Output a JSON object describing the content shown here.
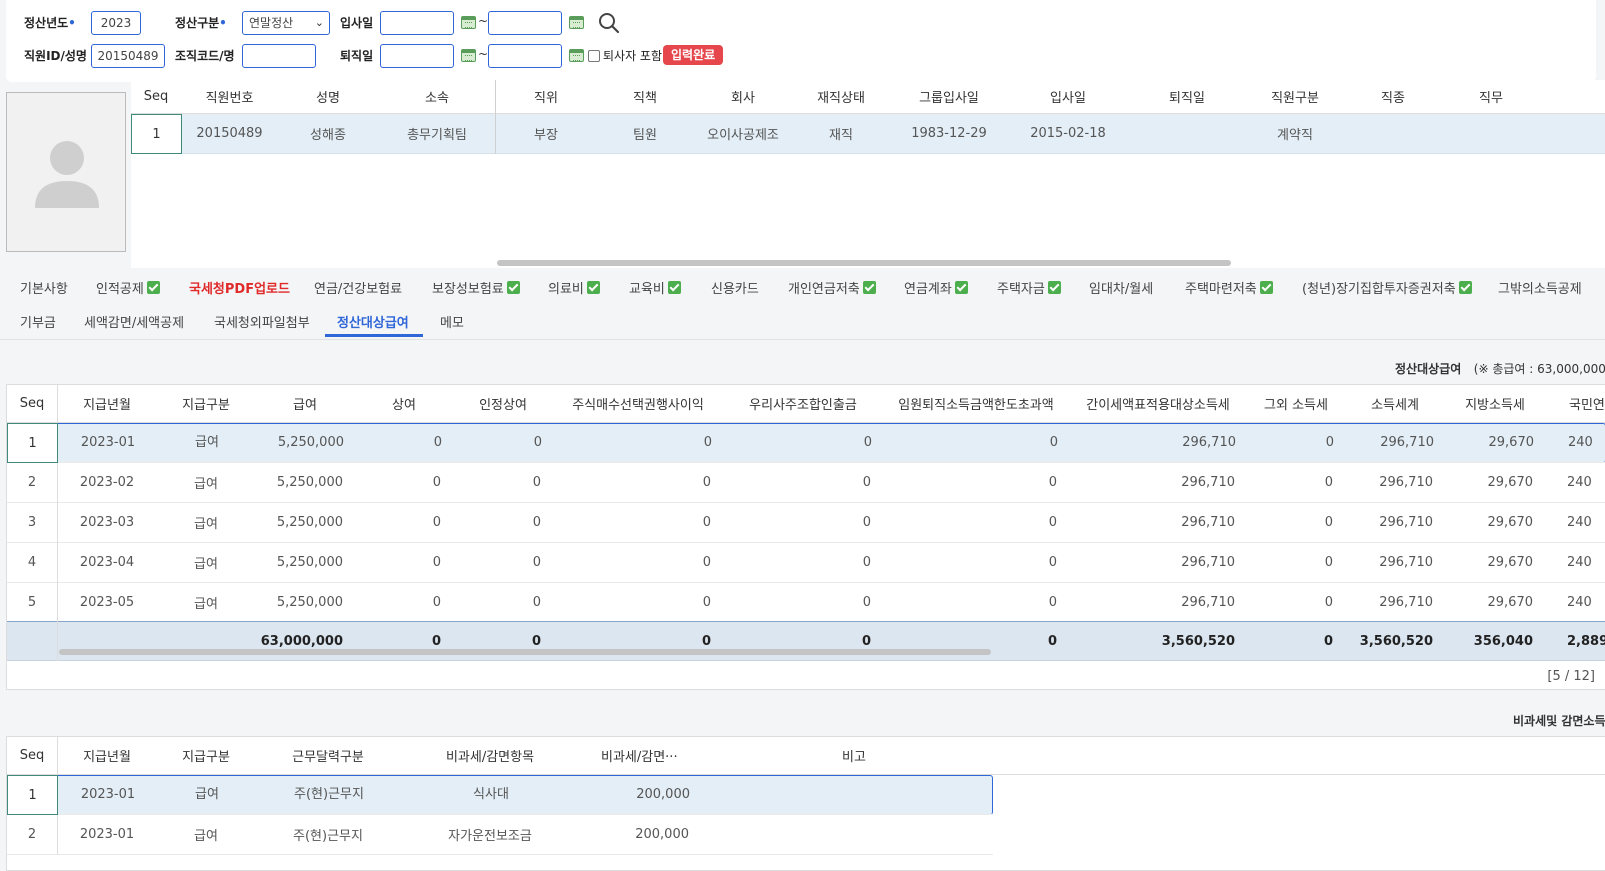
{
  "search": {
    "year_label": "정산년도",
    "year_value": "2023",
    "type_label": "정산구분",
    "type_value": "연말정산",
    "join_label": "입사일",
    "empid_label": "직원ID/성명",
    "empid_value": "20150489",
    "org_label": "조직코드/명",
    "retire_label": "퇴직일",
    "tilde": "~",
    "retiree_label": "퇴사자 포함",
    "status_badge": "입력완료",
    "required_mark": "•"
  },
  "employee_grid": {
    "columns": [
      "Seq",
      "직원번호",
      "성명",
      "소속",
      "직위",
      "직책",
      "회사",
      "재직상태",
      "그룹입사일",
      "입사일",
      "퇴직일",
      "직원구분",
      "직종",
      "직무"
    ],
    "row": [
      "1",
      "20150489",
      "성해종",
      "총무기획팀",
      "부장",
      "팀원",
      "오이사공제조",
      "재직",
      "1983-12-29",
      "2015-02-18",
      "",
      "계약직",
      "",
      ""
    ]
  },
  "tabs": {
    "row1": [
      {
        "label": "기본사항",
        "checked": false
      },
      {
        "label": "인적공제",
        "checked": true
      },
      {
        "label": "국세청PDF업로드",
        "checked": false
      },
      {
        "label": "연금/건강보험료",
        "checked": false
      },
      {
        "label": "보장성보험료",
        "checked": true
      },
      {
        "label": "의료비",
        "checked": true
      },
      {
        "label": "교육비",
        "checked": true
      },
      {
        "label": "신용카드",
        "checked": false
      },
      {
        "label": "개인연금저축",
        "checked": true
      },
      {
        "label": "연금계좌",
        "checked": true
      },
      {
        "label": "주택자금",
        "checked": true
      },
      {
        "label": "임대차/월세",
        "checked": false
      },
      {
        "label": "주택마련저축",
        "checked": true
      },
      {
        "label": "(청년)장기집합투자증권저축",
        "checked": true
      },
      {
        "label": "그밖의소득공제",
        "checked": false
      }
    ],
    "row2": [
      {
        "label": "기부금"
      },
      {
        "label": "세액감면/세액공제"
      },
      {
        "label": "국세청외파일첨부"
      },
      {
        "label": "정산대상급여"
      },
      {
        "label": "메모"
      }
    ],
    "active": "정산대상급여"
  },
  "salary": {
    "title": "정산대상급여",
    "total_note": "(※ 총급여 : 63,000,000)",
    "columns": [
      "Seq",
      "지급년월",
      "지급구분",
      "급여",
      "상여",
      "인정상여",
      "주식매수선택권행사이익",
      "우리사주조합인출금",
      "임원퇴직소득금액한도초과액",
      "간이세액표적용대상소득세",
      "그외 소득세",
      "소득세계",
      "지방소득세",
      "국민연"
    ],
    "rows": [
      [
        "1",
        "2023-01",
        "급여",
        "5,250,000",
        "0",
        "0",
        "0",
        "0",
        "0",
        "296,710",
        "0",
        "296,710",
        "29,670",
        "240"
      ],
      [
        "2",
        "2023-02",
        "급여",
        "5,250,000",
        "0",
        "0",
        "0",
        "0",
        "0",
        "296,710",
        "0",
        "296,710",
        "29,670",
        "240"
      ],
      [
        "3",
        "2023-03",
        "급여",
        "5,250,000",
        "0",
        "0",
        "0",
        "0",
        "0",
        "296,710",
        "0",
        "296,710",
        "29,670",
        "240"
      ],
      [
        "4",
        "2023-04",
        "급여",
        "5,250,000",
        "0",
        "0",
        "0",
        "0",
        "0",
        "296,710",
        "0",
        "296,710",
        "29,670",
        "240"
      ],
      [
        "5",
        "2023-05",
        "급여",
        "5,250,000",
        "0",
        "0",
        "0",
        "0",
        "0",
        "296,710",
        "0",
        "296,710",
        "29,670",
        "240"
      ]
    ],
    "summary": [
      "",
      "",
      "",
      "63,000,000",
      "0",
      "0",
      "0",
      "0",
      "0",
      "3,560,520",
      "0",
      "3,560,520",
      "356,040",
      "2,889"
    ],
    "pager": "[5 / 12]"
  },
  "nontax": {
    "title": "비과세및 감면소득",
    "columns": [
      "Seq",
      "지급년월",
      "지급구분",
      "근무달력구분",
      "비과세/감면항목",
      "비과세/감면···",
      "비고"
    ],
    "rows": [
      [
        "1",
        "2023-01",
        "급여",
        "주(현)근무지",
        "식사대",
        "200,000",
        ""
      ],
      [
        "2",
        "2023-01",
        "급여",
        "주(현)근무지",
        "자가운전보조금",
        "200,000",
        ""
      ]
    ]
  },
  "colors": {
    "accent": "#2f66d8",
    "danger": "#e02a2a",
    "check": "#4cae4c",
    "selected_row": "#e3eef6"
  }
}
